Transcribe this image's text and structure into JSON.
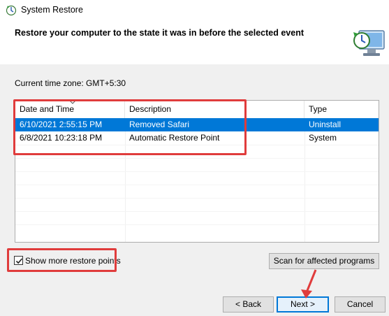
{
  "window": {
    "title": "System Restore"
  },
  "header": {
    "heading": "Restore your computer to the state it was in before the selected event"
  },
  "timezone": "Current time zone: GMT+5:30",
  "table": {
    "columns": [
      "Date and Time",
      "Description",
      "Type"
    ],
    "rows": [
      {
        "date": "6/10/2021 2:55:15 PM",
        "description": "Removed Safari",
        "type": "Uninstall",
        "selected": true
      },
      {
        "date": "6/8/2021 10:23:18 PM",
        "description": "Automatic Restore Point",
        "type": "System",
        "selected": false
      }
    ]
  },
  "options": {
    "show_more_label": "Show more restore points",
    "show_more_checked": true
  },
  "buttons": {
    "scan": "Scan for affected programs",
    "back": "< Back",
    "next": "Next >",
    "cancel": "Cancel"
  },
  "colors": {
    "selection": "#0078d7",
    "annotation": "#e03c3c"
  },
  "icons": {
    "title": "system-restore-icon",
    "header": "restore-computer-icon"
  }
}
